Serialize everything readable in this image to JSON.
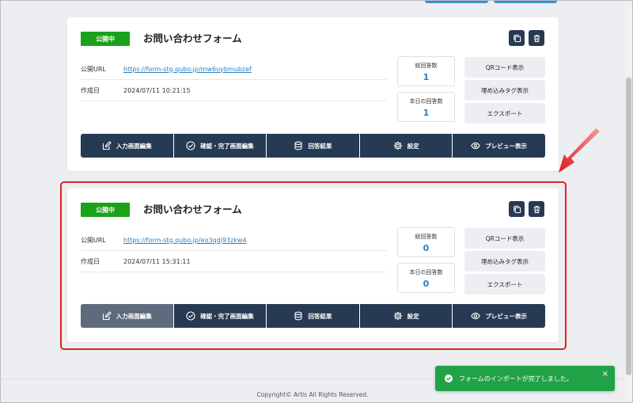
{
  "cards": [
    {
      "status_badge": "公開中",
      "title": "お問い合わせフォーム",
      "public_url_label": "公開URL",
      "public_url": "https://form-stg.qubo.jp/mw6uybmubzef",
      "created_label": "作成日",
      "created_value": "2024/07/11 10:21:15",
      "total_answers_label": "総回答数",
      "total_answers": "1",
      "today_answers_label": "本日の回答数",
      "today_answers": "1",
      "qr_button": "QRコード表示",
      "embed_tag_button": "埋め込みタグ表示",
      "export_button": "エクスポート",
      "actions": [
        "入力画面編集",
        "確認・完了画面編集",
        "回答結果",
        "設定",
        "プレビュー表示"
      ]
    },
    {
      "status_badge": "公開中",
      "title": "お問い合わせフォーム",
      "public_url_label": "公開URL",
      "public_url": "https://form-stg.qubo.jp/eo3qdj93zkw4",
      "created_label": "作成日",
      "created_value": "2024/07/11 15:31:11",
      "total_answers_label": "総回答数",
      "total_answers": "0",
      "today_answers_label": "本日の回答数",
      "today_answers": "0",
      "qr_button": "QRコード表示",
      "embed_tag_button": "埋め込みタグ表示",
      "export_button": "エクスポート",
      "actions": [
        "入力画面編集",
        "確認・完了画面編集",
        "回答結果",
        "設定",
        "プレビュー表示"
      ]
    }
  ],
  "footer": {
    "copyright": "Copyright© Artis All Rights Reserved."
  },
  "toast": {
    "message": "フォームのインポートが完了しました。",
    "close": "×"
  },
  "colors": {
    "badge_green": "#1aa21a",
    "navy": "#263a54",
    "link_blue": "#2a7fc0",
    "highlight_red": "#e52020",
    "toast_green": "#22a247"
  },
  "icons": {
    "actions": [
      "edit-icon",
      "check-circle-icon",
      "database-icon",
      "gear-icon",
      "eye-icon"
    ]
  }
}
